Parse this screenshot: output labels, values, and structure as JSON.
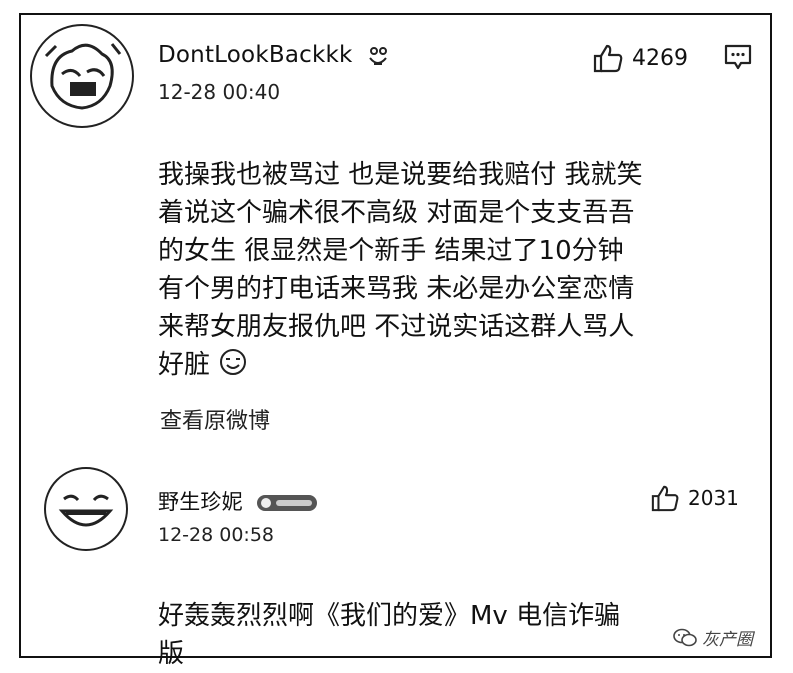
{
  "comments": [
    {
      "username": "DontLookBackkk",
      "timestamp": "12-28 00:40",
      "likes": "4269",
      "text": "我操我也被骂过 也是说要给我赔付 我就笑\n着说这个骗术很不高级 对面是个支支吾吾\n的女生 很显然是个新手 结果过了10分钟\n有个男的打电话来骂我 未必是办公室恋情\n来帮女朋友报仇吧 不过说实话这群人骂人\n好脏",
      "view_original": "查看原微博"
    },
    {
      "username": "野生珍妮",
      "timestamp": "12-28 00:58",
      "likes": "2031",
      "text": "好轰轰烈烈啊《我们的爱》Mv  电信诈骗\n版"
    }
  ],
  "watermark": "灰产圈",
  "icons": {
    "like": "thumbs-up-icon",
    "more": "comment-more-icon",
    "emoji": "smile-emoji-icon",
    "wechat": "wechat-icon"
  }
}
